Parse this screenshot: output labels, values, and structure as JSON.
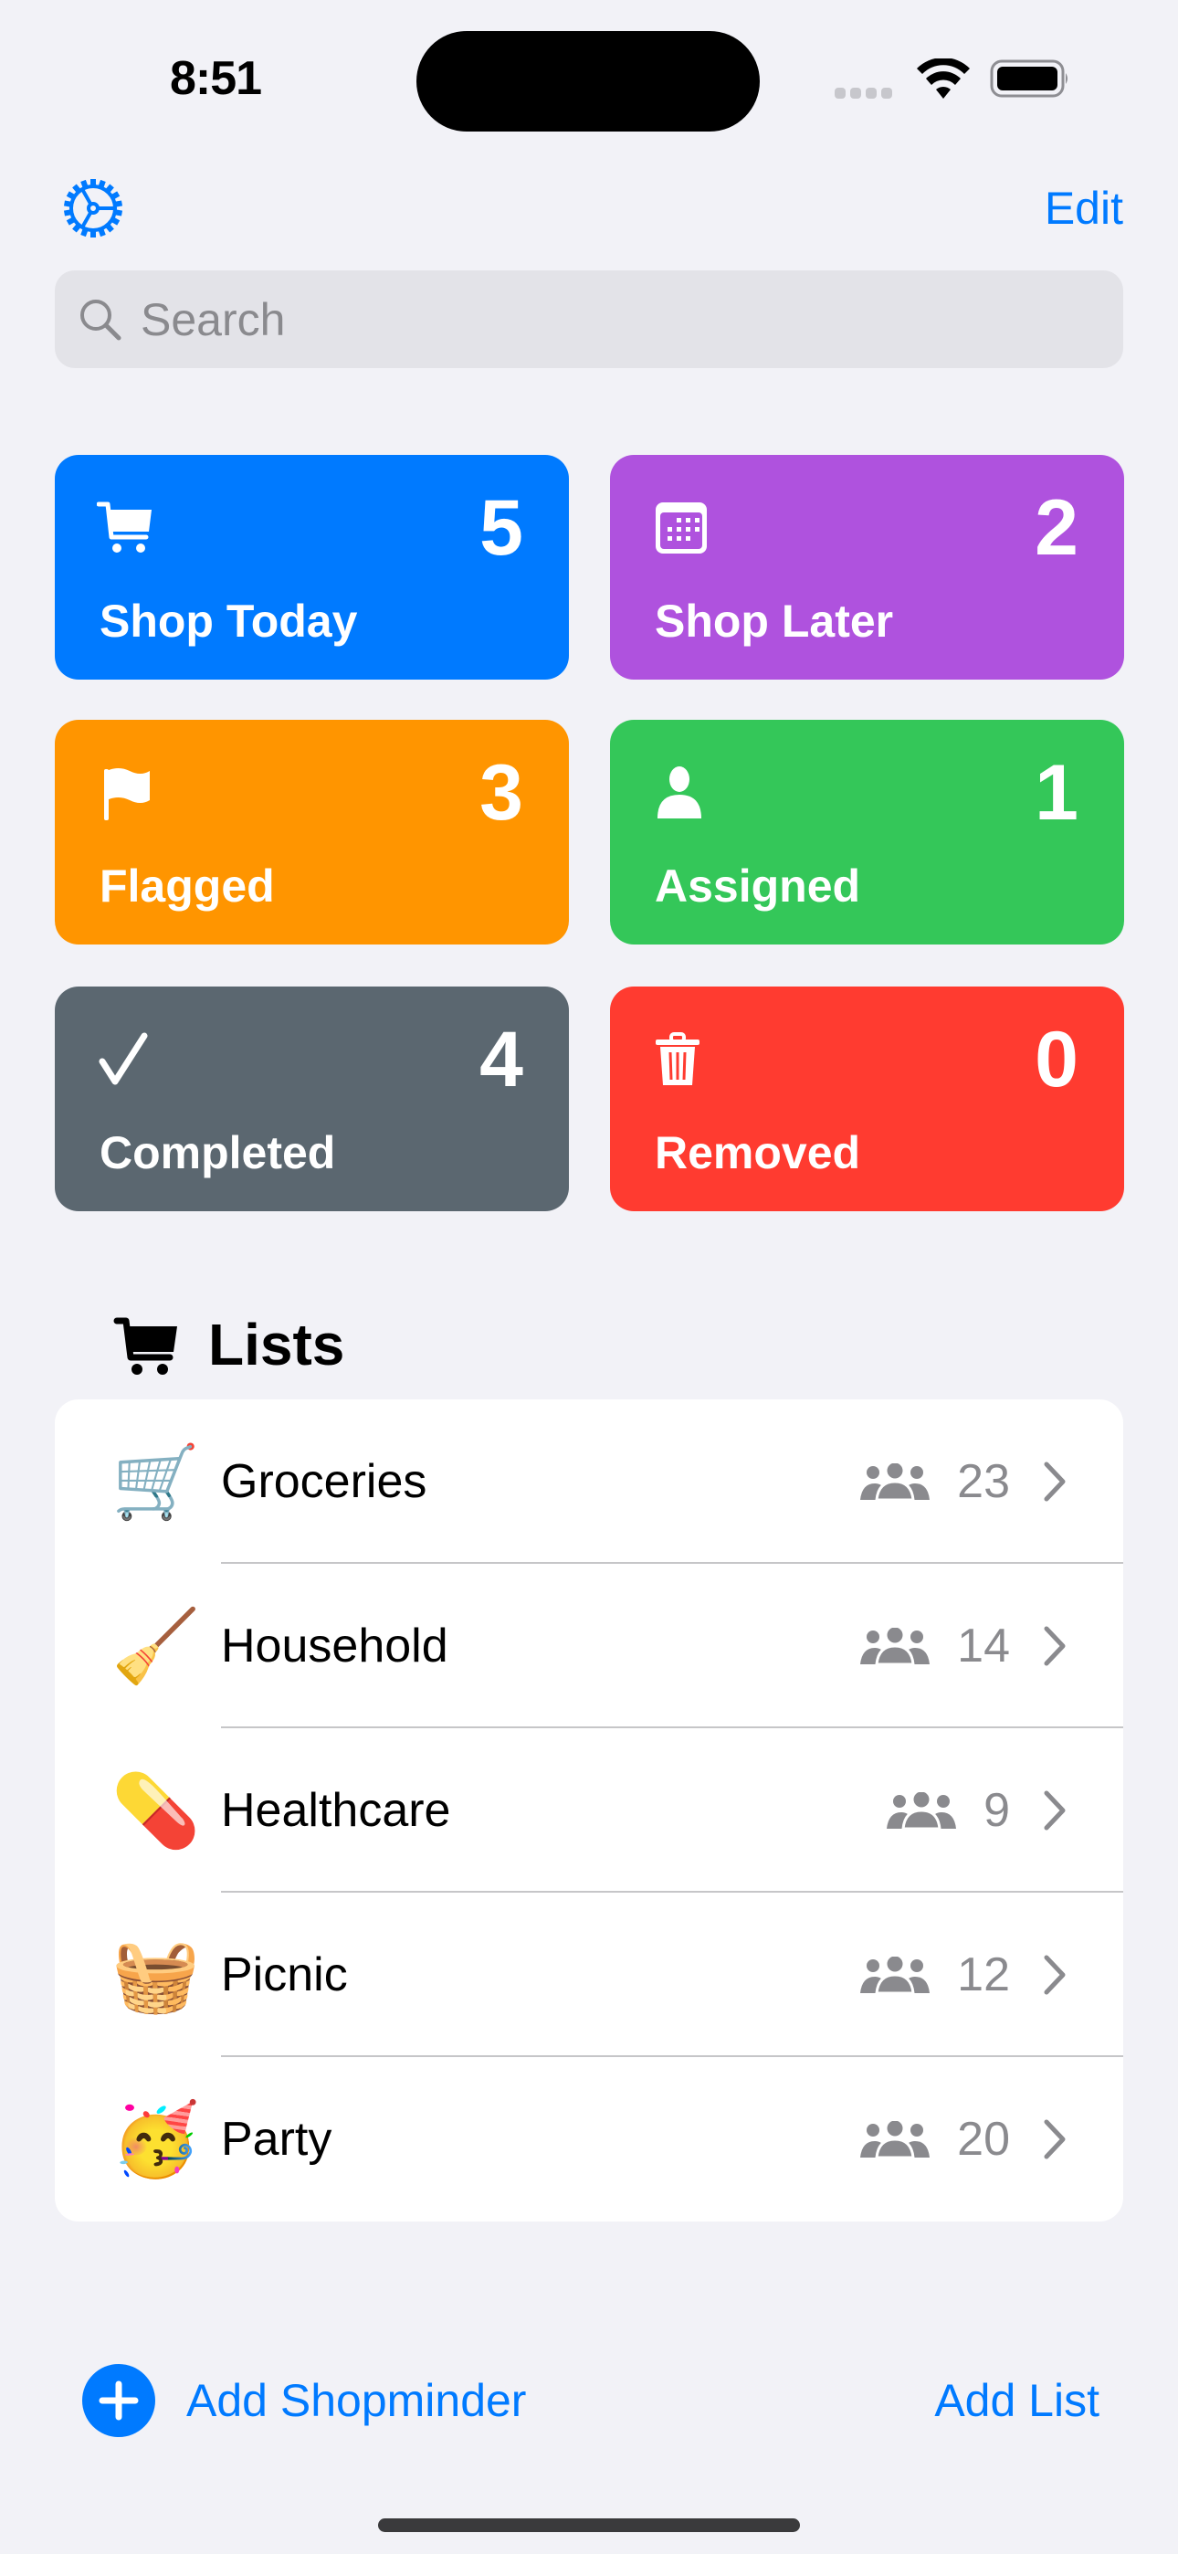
{
  "status_bar": {
    "time": "8:51"
  },
  "nav": {
    "edit_label": "Edit"
  },
  "search": {
    "placeholder": "Search",
    "value": ""
  },
  "tiles": [
    {
      "label": "Shop Today",
      "count": "5",
      "icon": "cart-icon",
      "color": "#007aff"
    },
    {
      "label": "Shop Later",
      "count": "2",
      "icon": "calendar-icon",
      "color": "#af52de"
    },
    {
      "label": "Flagged",
      "count": "3",
      "icon": "flag-icon",
      "color": "#ff9500"
    },
    {
      "label": "Assigned",
      "count": "1",
      "icon": "person-icon",
      "color": "#34c759"
    },
    {
      "label": "Completed",
      "count": "4",
      "icon": "checkmark-icon",
      "color": "#5b6770"
    },
    {
      "label": "Removed",
      "count": "0",
      "icon": "trash-icon",
      "color": "#ff3b30"
    }
  ],
  "lists_section": {
    "title": "Lists",
    "icon": "cart-icon",
    "items": [
      {
        "emoji": "🛒",
        "name": "Groceries",
        "shared_icon": "people-icon",
        "count": "23"
      },
      {
        "emoji": "🧹",
        "name": "Household",
        "shared_icon": "people-icon",
        "count": "14"
      },
      {
        "emoji": "💊",
        "name": "Healthcare",
        "shared_icon": "people-icon",
        "count": "9"
      },
      {
        "emoji": "🧺",
        "name": "Picnic",
        "shared_icon": "people-icon",
        "count": "12"
      },
      {
        "emoji": "🥳",
        "name": "Party",
        "shared_icon": "people-icon",
        "count": "20"
      }
    ]
  },
  "toolbar": {
    "add_shopminder_label": "Add Shopminder",
    "add_list_label": "Add List"
  },
  "colors": {
    "accent": "#007aff",
    "background": "#f2f2f7",
    "secondary_text": "#8a8a8e"
  }
}
